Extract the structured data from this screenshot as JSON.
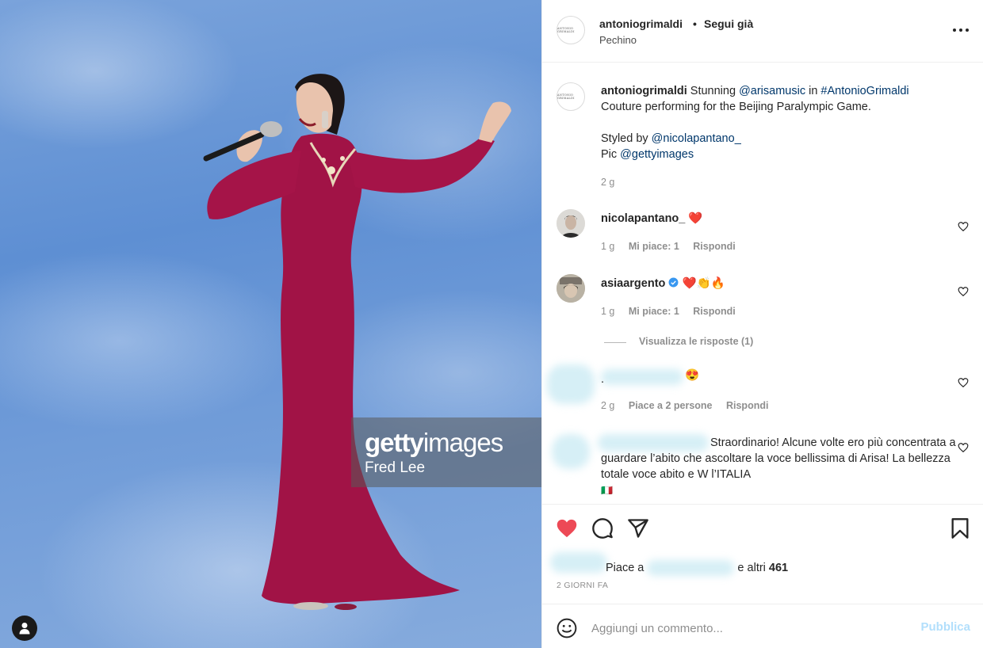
{
  "photo": {
    "watermark_brand_bold": "getty",
    "watermark_brand_thin": "images",
    "watermark_credit": "Fred Lee",
    "user_button_icon": "user-icon"
  },
  "header": {
    "avatar_text": "ANTONIO GRIMALDI",
    "username": "antoniogrimaldi",
    "dot": "•",
    "follow_label": "Segui già",
    "location": "Pechino",
    "more_icon": "more-horizontal-icon"
  },
  "caption": {
    "username": "antoniogrimaldi",
    "text_1": " Stunning ",
    "mention_1": "@arisamusic",
    "text_2": " in ",
    "hashtag": "#AntonioGrimaldi",
    "text_3": "Couture performing for the Beijing Paralympic Game.",
    "styled_by": "Styled by ",
    "mention_2": "@nicolapantano_",
    "pic": "Pic ",
    "mention_3": "@gettyimages",
    "time": "2 g"
  },
  "comments": [
    {
      "username": "nicolapantano_",
      "text": "❤️",
      "time": "1 g",
      "likes": "Mi piace: 1",
      "reply": "Rispondi"
    },
    {
      "username": "asiaargento",
      "verified": true,
      "text": "❤️👏🔥",
      "time": "1 g",
      "likes": "Mi piace: 1",
      "reply": "Rispondi",
      "view_replies": "Visualizza le risposte (1)"
    },
    {
      "username": "",
      "text": ".",
      "emoji": "😍",
      "time": "2 g",
      "likes": "Piace a 2 persone",
      "reply": "Rispondi"
    },
    {
      "username": "",
      "text": "Straordinario! Alcune volte ero più concentrata a guardare l’abito che ascoltare la voce bellissima di Arisa! La bellezza totale voce abito e W l’ITALIA",
      "flag": "🇮🇹"
    }
  ],
  "actions": {
    "like_icon": "heart-filled-icon",
    "comment_icon": "comment-icon",
    "share_icon": "send-icon",
    "save_icon": "bookmark-icon",
    "accent_like": "#ed4956",
    "likes_prefix": "Piace a ",
    "likes_suffix": " e altri ",
    "likes_count": "461",
    "timestamp": "2 GIORNI FA"
  },
  "add_comment": {
    "emoji_icon": "emoji-smile-icon",
    "placeholder": "Aggiungi un commento...",
    "publish_label": "Pubblica",
    "publish_color": "#b2dffc"
  }
}
